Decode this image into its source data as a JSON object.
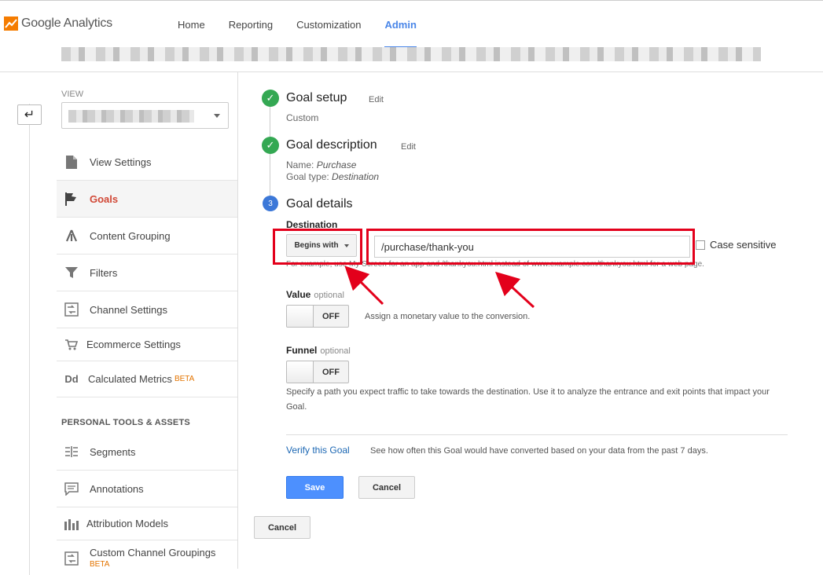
{
  "header": {
    "logo_text": "Google Analytics",
    "nav": [
      {
        "label": "Home"
      },
      {
        "label": "Reporting"
      },
      {
        "label": "Customization"
      },
      {
        "label": "Admin"
      }
    ]
  },
  "sidebar": {
    "view_label": "VIEW",
    "items": [
      {
        "label": "View Settings",
        "icon": "document-icon"
      },
      {
        "label": "Goals",
        "icon": "flag-icon"
      },
      {
        "label": "Content Grouping",
        "icon": "grouping-icon"
      },
      {
        "label": "Filters",
        "icon": "filter-icon"
      },
      {
        "label": "Channel Settings",
        "icon": "channel-icon"
      },
      {
        "label": "Ecommerce Settings",
        "icon": "cart-icon"
      },
      {
        "label": "Calculated Metrics",
        "icon": "dd-icon",
        "icon_text": "Dd",
        "badge": "BETA"
      }
    ],
    "section_title": "PERSONAL TOOLS & ASSETS",
    "personal_items": [
      {
        "label": "Segments",
        "icon": "segments-icon"
      },
      {
        "label": "Annotations",
        "icon": "annotation-icon"
      },
      {
        "label": "Attribution Models",
        "icon": "bar-chart-icon"
      },
      {
        "label": "Custom Channel Groupings",
        "icon": "channel-grouping-icon",
        "badge": "BETA"
      }
    ]
  },
  "goal": {
    "setup": {
      "title": "Goal setup",
      "edit": "Edit",
      "value": "Custom"
    },
    "description": {
      "title": "Goal description",
      "edit": "Edit",
      "name_label": "Name:",
      "name_value": "Purchase",
      "type_label": "Goal type:",
      "type_value": "Destination"
    },
    "details": {
      "step_number": "3",
      "title": "Goal details",
      "destination_label": "Destination",
      "match_type": "Begins with",
      "destination_value": "/purchase/thank-you",
      "case_sensitive_label": "Case sensitive",
      "help_text": "For example, use My Screen for an app and /thankyou.html instead of www.example.com/thankyou.html for a web page.",
      "value_label": "Value",
      "value_optional": "optional",
      "value_toggle": "OFF",
      "value_desc": "Assign a monetary value to the conversion.",
      "funnel_label": "Funnel",
      "funnel_optional": "optional",
      "funnel_toggle": "OFF",
      "funnel_desc": "Specify a path you expect traffic to take towards the destination. Use it to analyze the entrance and exit points that impact your Goal.",
      "verify_link": "Verify this Goal",
      "verify_desc": "See how often this Goal would have converted based on your data from the past 7 days.",
      "save_label": "Save",
      "cancel_label": "Cancel"
    },
    "outer_cancel_label": "Cancel"
  },
  "colors": {
    "accent": "#4a86e8",
    "active_sidebar": "#d14836",
    "check_green": "#34a853",
    "annotation_red": "#e3001b"
  }
}
